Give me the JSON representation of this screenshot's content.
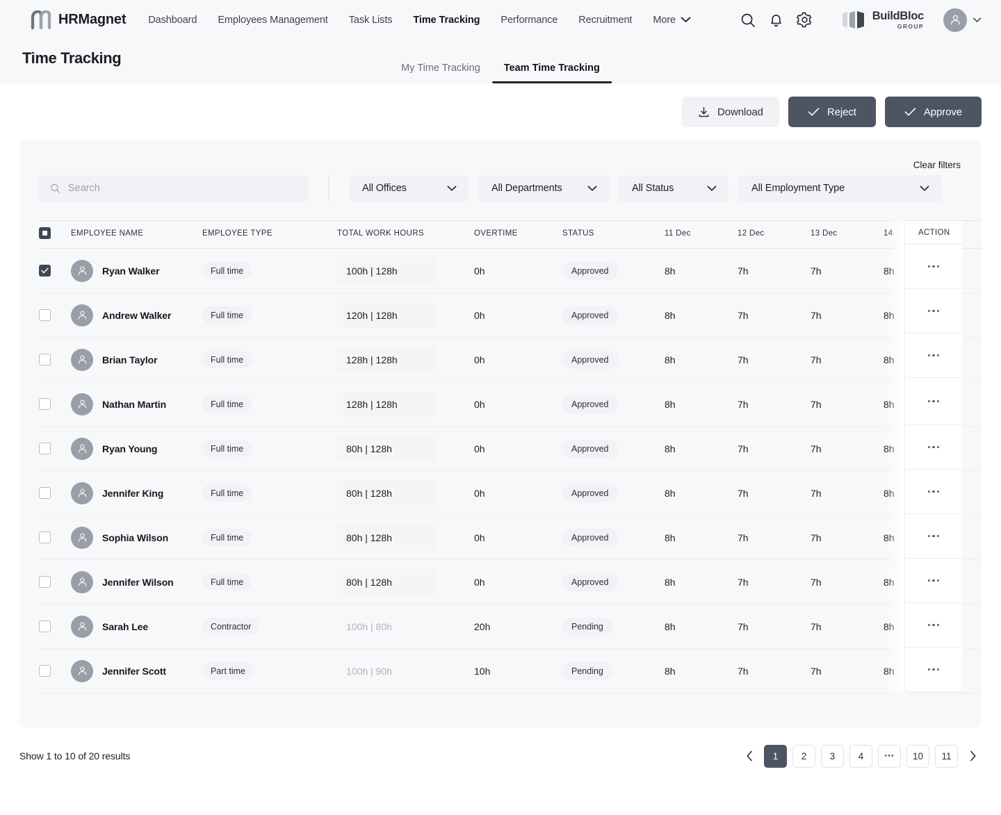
{
  "topnav": {
    "brand": "HRMagnet",
    "links": [
      {
        "label": "Dashboard",
        "active": false
      },
      {
        "label": "Employees Management",
        "active": false
      },
      {
        "label": "Task Lists",
        "active": false
      },
      {
        "label": "Time Tracking",
        "active": true
      },
      {
        "label": "Performance",
        "active": false
      },
      {
        "label": "Recruitment",
        "active": false
      }
    ],
    "more_label": "More",
    "icons": [
      "search-icon",
      "bell-icon",
      "gear-icon"
    ],
    "company": {
      "name": "BuildBloc",
      "sub": "GROUP"
    }
  },
  "page": {
    "title": "Time Tracking",
    "tabs": [
      {
        "label": "My Time Tracking",
        "active": false
      },
      {
        "label": "Team Time Tracking",
        "active": true
      }
    ]
  },
  "actions": {
    "download": "Download",
    "reject": "Reject",
    "approve": "Approve"
  },
  "filters": {
    "clear": "Clear filters",
    "search_placeholder": "Search",
    "search_value": "",
    "offices": "All Offices",
    "departments": "All Departments",
    "status": "All Status",
    "employment_type": "All Employment Type"
  },
  "table": {
    "columns": {
      "employee_name": "EMPLOYEE NAME",
      "employee_type": "EMPLOYEE TYPE",
      "total_work_hours": "TOTAL WORK HOURS",
      "overtime": "OVERTIME",
      "status": "STATUS",
      "action": "ACTION",
      "days": [
        "11 Dec",
        "12 Dec",
        "13 Dec",
        "14"
      ]
    },
    "rows": [
      {
        "checked": true,
        "name": "Ryan Walker",
        "type": "Full time",
        "hours": "100h | 128h",
        "hours_muted": false,
        "overtime": "0h",
        "status": "Approved",
        "days": [
          "8h",
          "7h",
          "7h",
          "8h"
        ]
      },
      {
        "checked": false,
        "name": "Andrew Walker",
        "type": "Full time",
        "hours": "120h | 128h",
        "hours_muted": false,
        "overtime": "0h",
        "status": "Approved",
        "days": [
          "8h",
          "7h",
          "7h",
          "8h"
        ]
      },
      {
        "checked": false,
        "name": "Brian Taylor",
        "type": "Full time",
        "hours": "128h | 128h",
        "hours_muted": false,
        "overtime": "0h",
        "status": "Approved",
        "days": [
          "8h",
          "7h",
          "7h",
          "8h"
        ]
      },
      {
        "checked": false,
        "name": "Nathan Martin",
        "type": "Full time",
        "hours": "128h | 128h",
        "hours_muted": false,
        "overtime": "0h",
        "status": "Approved",
        "days": [
          "8h",
          "7h",
          "7h",
          "8h"
        ]
      },
      {
        "checked": false,
        "name": "Ryan Young",
        "type": "Full time",
        "hours": "80h | 128h",
        "hours_muted": false,
        "overtime": "0h",
        "status": "Approved",
        "days": [
          "8h",
          "7h",
          "7h",
          "8h"
        ]
      },
      {
        "checked": false,
        "name": "Jennifer King",
        "type": "Full time",
        "hours": "80h | 128h",
        "hours_muted": false,
        "overtime": "0h",
        "status": "Approved",
        "days": [
          "8h",
          "7h",
          "7h",
          "8h"
        ]
      },
      {
        "checked": false,
        "name": "Sophia Wilson",
        "type": "Full time",
        "hours": "80h | 128h",
        "hours_muted": false,
        "overtime": "0h",
        "status": "Approved",
        "days": [
          "8h",
          "7h",
          "7h",
          "8h"
        ]
      },
      {
        "checked": false,
        "name": "Jennifer Wilson",
        "type": "Full time",
        "hours": "80h | 128h",
        "hours_muted": false,
        "overtime": "0h",
        "status": "Approved",
        "days": [
          "8h",
          "7h",
          "7h",
          "8h"
        ]
      },
      {
        "checked": false,
        "name": "Sarah Lee",
        "type": "Contractor",
        "hours": "100h | 80h",
        "hours_muted": true,
        "overtime": "20h",
        "status": "Pending",
        "days": [
          "8h",
          "7h",
          "7h",
          "8h"
        ]
      },
      {
        "checked": false,
        "name": "Jennifer Scott",
        "type": "Part time",
        "hours": "100h | 90h",
        "hours_muted": true,
        "overtime": "10h",
        "status": "Pending",
        "days": [
          "8h",
          "7h",
          "7h",
          "8h"
        ]
      }
    ]
  },
  "footer": {
    "results": "Show 1 to 10 of 20 results",
    "pages": [
      "1",
      "2",
      "3",
      "4",
      "•••",
      "10",
      "11"
    ],
    "active_page": "1"
  },
  "colors": {
    "accent_dark": "#4d5463",
    "page_bg": "#f7f8fa",
    "chip_bg": "#f1f2f5"
  }
}
